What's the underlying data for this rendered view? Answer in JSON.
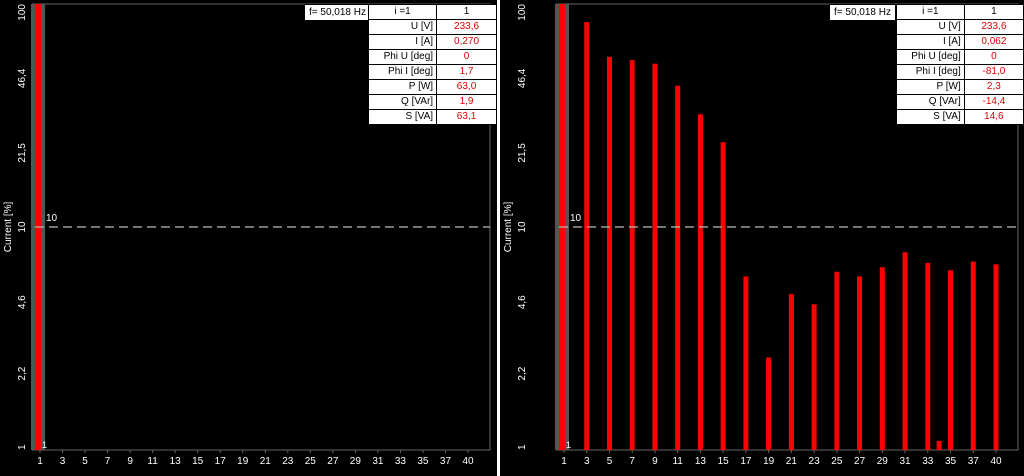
{
  "panels": [
    {
      "freq": "f= 50,018 Hz",
      "table": {
        "header_i": "i =1",
        "header_val": "1",
        "rows": [
          {
            "label": "U [V]",
            "value": "233,6"
          },
          {
            "label": "I [A]",
            "value": "0,270"
          },
          {
            "label": "Phi U [deg]",
            "value": "0"
          },
          {
            "label": "Phi I [deg]",
            "value": "1,7"
          },
          {
            "label": "P [W]",
            "value": "63,0"
          },
          {
            "label": "Q [VAr]",
            "value": "1,9"
          },
          {
            "label": "S [VA]",
            "value": "63,1"
          }
        ]
      }
    },
    {
      "freq": "f= 50,018 Hz",
      "table": {
        "header_i": "i =1",
        "header_val": "1",
        "rows": [
          {
            "label": "U [V]",
            "value": "233,6"
          },
          {
            "label": "I [A]",
            "value": "0,062"
          },
          {
            "label": "Phi U [deg]",
            "value": "0"
          },
          {
            "label": "Phi I [deg]",
            "value": "-81,0"
          },
          {
            "label": "P [W]",
            "value": "2,3"
          },
          {
            "label": "Q [VAr]",
            "value": "-14,4"
          },
          {
            "label": "S [VA]",
            "value": "14,6"
          }
        ]
      }
    }
  ],
  "colors": {
    "bar": "#ff0000",
    "fundamental_bg": "#555555",
    "ref_line": "#bbbbbb"
  },
  "chart_data": [
    {
      "type": "bar",
      "ylabel": "Current [%]",
      "yscale": "log",
      "ylim": [
        1,
        100
      ],
      "yticks": [
        "100",
        "46,4",
        "21,5",
        "10",
        "4,6",
        "2,2",
        "1"
      ],
      "ytick_values": [
        100,
        46.4,
        21.5,
        10,
        4.6,
        2.2,
        1
      ],
      "xticks": [
        "1",
        "3",
        "5",
        "7",
        "9",
        "11",
        "13",
        "15",
        "17",
        "19",
        "21",
        "23",
        "25",
        "27",
        "29",
        "31",
        "33",
        "35",
        "37",
        "40"
      ],
      "ref_line": {
        "value": 10,
        "label": "10"
      },
      "fundamental_label": "1",
      "harmonics": [
        1
      ],
      "values": [
        100
      ]
    },
    {
      "type": "bar",
      "ylabel": "Current [%]",
      "yscale": "log",
      "ylim": [
        1,
        100
      ],
      "yticks": [
        "100",
        "46,4",
        "21,5",
        "10",
        "4,6",
        "2,2",
        "1"
      ],
      "ytick_values": [
        100,
        46.4,
        21.5,
        10,
        4.6,
        2.2,
        1
      ],
      "xticks": [
        "1",
        "3",
        "5",
        "7",
        "9",
        "11",
        "13",
        "15",
        "17",
        "19",
        "21",
        "23",
        "25",
        "27",
        "29",
        "31",
        "33",
        "35",
        "37",
        "40"
      ],
      "ref_line": {
        "value": 10,
        "label": "10"
      },
      "fundamental_label": "1",
      "harmonics": [
        1,
        3,
        5,
        7,
        9,
        11,
        13,
        15,
        17,
        19,
        21,
        23,
        25,
        27,
        29,
        31,
        33,
        34,
        35,
        37,
        39
      ],
      "values": [
        100,
        83,
        58,
        56,
        54,
        43,
        32,
        24,
        6.0,
        2.6,
        5.0,
        4.5,
        6.3,
        6.0,
        6.6,
        7.7,
        6.9,
        1.1,
        6.4,
        7.0,
        6.8
      ]
    }
  ]
}
